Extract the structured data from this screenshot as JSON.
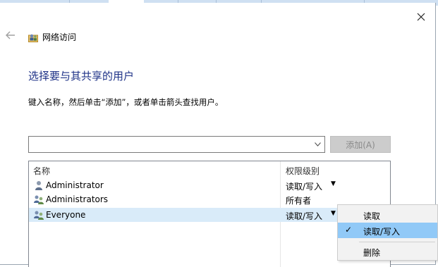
{
  "wizard": {
    "title": "网络访问"
  },
  "main": {
    "heading": "选择要与其共享的用户",
    "instruction": "键入名称，然后单击“添加”，或者单击箭头查找用户。",
    "name_input_value": "",
    "add_button": "添加(A)"
  },
  "list": {
    "col_name": "名称",
    "col_permission": "权限级别",
    "rows": [
      {
        "name": "Administrator",
        "permission": "读取/写入",
        "icon": "single-user-icon"
      },
      {
        "name": "Administrators",
        "permission": "所有者",
        "icon": "user-group-icon"
      },
      {
        "name": "Everyone",
        "permission": "读取/写入",
        "icon": "user-group-icon"
      }
    ]
  },
  "context_menu": {
    "items": [
      {
        "label": "读取",
        "checked": false
      },
      {
        "label": "读取/写入",
        "checked": true
      },
      {
        "label": "删除",
        "checked": false
      }
    ],
    "check_glyph": "✓"
  },
  "colors": {
    "heading": "#1e3287",
    "selected_row": "#d9ebf9",
    "menu_highlight": "#91c9f7"
  }
}
